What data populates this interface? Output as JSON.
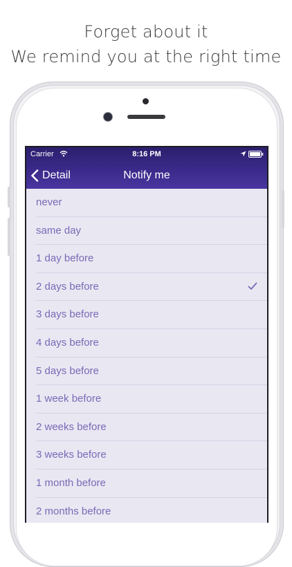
{
  "promo": {
    "line1": "Forget about it",
    "line2": "We remind you at the right time"
  },
  "status_bar": {
    "carrier": "Carrier",
    "time": "8:16 PM",
    "icons": [
      "wifi-icon",
      "location-icon",
      "battery-icon"
    ]
  },
  "nav": {
    "back_label": "Detail",
    "title": "Notify me"
  },
  "options": [
    {
      "label": "never",
      "selected": false
    },
    {
      "label": "same day",
      "selected": false
    },
    {
      "label": "1 day before",
      "selected": false
    },
    {
      "label": "2 days before",
      "selected": true
    },
    {
      "label": "3 days before",
      "selected": false
    },
    {
      "label": "4 days before",
      "selected": false
    },
    {
      "label": "5 days before",
      "selected": false
    },
    {
      "label": "1 week before",
      "selected": false
    },
    {
      "label": "2 weeks before",
      "selected": false
    },
    {
      "label": "3 weeks before",
      "selected": false
    },
    {
      "label": "1 month before",
      "selected": false
    },
    {
      "label": "2 months before",
      "selected": false
    }
  ],
  "colors": {
    "nav_bar": "#3b2a8a",
    "list_background": "#e9e7f2",
    "option_text": "#7a6ab6",
    "checkmark": "#7a6ab6"
  }
}
